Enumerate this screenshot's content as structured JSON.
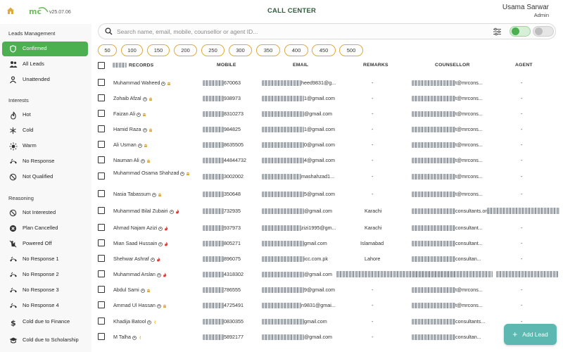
{
  "header": {
    "version": "v25.07.06",
    "title": "CALL CENTER",
    "user_name": "Usama Sarwar",
    "user_role": "Admin"
  },
  "sidebar": {
    "sections": [
      {
        "title": "Leads Management",
        "items": [
          {
            "label": "Confirmed",
            "icon": "shield-icon",
            "active": true
          },
          {
            "label": "All Leads",
            "icon": "users-icon"
          },
          {
            "label": "Unattended",
            "icon": "user-icon"
          }
        ]
      },
      {
        "title": "Interests",
        "items": [
          {
            "label": "Hot",
            "icon": "flame-icon"
          },
          {
            "label": "Cold",
            "icon": "snowflake-icon"
          },
          {
            "label": "Warm",
            "icon": "sun-icon"
          },
          {
            "label": "No Response",
            "icon": "phone-hangup-icon"
          },
          {
            "label": "Not Qualified",
            "icon": "ban-icon"
          }
        ]
      },
      {
        "title": "Reasoning",
        "items": [
          {
            "label": "Not Interested",
            "icon": "ban-icon"
          },
          {
            "label": "Plan Cancelled",
            "icon": "x-circle-icon"
          },
          {
            "label": "Powered Off",
            "icon": "power-off-icon"
          },
          {
            "label": "No Response 1",
            "icon": "phone-hangup-icon"
          },
          {
            "label": "No Response 2",
            "icon": "phone-hangup-icon"
          },
          {
            "label": "No Response 3",
            "icon": "phone-hangup-icon"
          },
          {
            "label": "No Response 4",
            "icon": "phone-hangup-icon"
          },
          {
            "label": "Cold due to Finance",
            "icon": "dollar-icon"
          },
          {
            "label": "Cold due to Scholarship",
            "icon": "graduation-cap-icon"
          }
        ]
      }
    ]
  },
  "search": {
    "placeholder": "Search name, email, mobile, counsellor or agent ID..."
  },
  "page_sizes": [
    "50",
    "100",
    "150",
    "200",
    "250",
    "300",
    "350",
    "400",
    "450",
    "500"
  ],
  "table": {
    "headers": {
      "records": "RECORDS",
      "mobile": "MOBILE",
      "email": "EMAIL",
      "remarks": "REMARKS",
      "counsellor": "COUNSELLOR",
      "agent": "AGENT"
    },
    "rows": [
      {
        "name": "Muhammad Waheed",
        "name2": "",
        "tag": "bank",
        "mobile": "670063",
        "email": "heed9831@g...",
        "remarks": "-",
        "counsellor": "t@mrcons...",
        "agent": "-"
      },
      {
        "name": "Zohaib Afzal",
        "name2": "",
        "tag": "bank",
        "mobile": "938973",
        "email": "1@gmail.com",
        "remarks": "-",
        "counsellor": "t@mrcons...",
        "agent": "-"
      },
      {
        "name": "Faizan Ali",
        "name2": "",
        "tag": "bank",
        "mobile": "8310273",
        "email": "@gmail.com",
        "remarks": "-",
        "counsellor": "t@mrcons...",
        "agent": "-"
      },
      {
        "name": "Hamid Raza",
        "name2": "",
        "tag": "bank",
        "mobile": "984825",
        "email": "1@gmail.com",
        "remarks": "-",
        "counsellor": "t@mrcons...",
        "agent": "-"
      },
      {
        "name": "Ali Usman",
        "name2": "",
        "tag": "bank",
        "mobile": "8635505",
        "email": "0@gmail.com",
        "remarks": "-",
        "counsellor": "t@mrcons...",
        "agent": "-"
      },
      {
        "name": "Nauman Ali",
        "name2": "",
        "tag": "bank",
        "mobile": "44844732",
        "email": "4@gmail.com",
        "remarks": "-",
        "counsellor": "t@mrcons...",
        "agent": "-"
      },
      {
        "name": "Muhammad Osama Shahzad",
        "name2": "",
        "tag": "bank",
        "mobile": "3002002",
        "email": "mashahzad1...",
        "remarks": "-",
        "counsellor": "t@mrcons...",
        "agent": "-"
      },
      {
        "name": "Nasia Tabassum",
        "name2": "",
        "tag": "bank",
        "mobile": "350648",
        "email": "5@gmail.com",
        "remarks": "-",
        "counsellor": "t@mrcons...",
        "agent": "-"
      },
      {
        "name": "Muhammad Bilal Zubairi",
        "name2": "",
        "tag": "flame",
        "mobile": "732935",
        "email": "@gmail.com",
        "remarks": "Karachi",
        "counsellor": "consultants.org",
        "agent": ""
      },
      {
        "name": "Ahmad Najam Azizi",
        "name2": "",
        "tag": "flame",
        "mobile": "937973",
        "email": "zizi1995@gm...",
        "remarks": "Karachi",
        "counsellor": "consultant...",
        "agent": "-"
      },
      {
        "name": "Mian Saad Hussain",
        "name2": "",
        "tag": "flame",
        "mobile": "805271",
        "email": "gmail.com",
        "remarks": "Islamabad",
        "counsellor": "consultant...",
        "agent": "-"
      },
      {
        "name": "Shehwar Ashraf",
        "name2": "",
        "tag": "flame",
        "mobile": "896075",
        "email": "icc.com.pk",
        "remarks": "Lahore",
        "counsellor": "consultan...",
        "agent": "-"
      },
      {
        "name": "Muhammad Arslan",
        "name2": "",
        "tag": "flame",
        "mobile": "4318302",
        "email": "@gmail.com",
        "remarks": "",
        "counsellor": "",
        "agent": ""
      },
      {
        "name": "Abdul Sami",
        "name2": "",
        "tag": "bank",
        "mobile": "786555",
        "email": "9@gmail.com",
        "remarks": "-",
        "counsellor": "t@mrcons...",
        "agent": "-"
      },
      {
        "name": "Ammad Ul Hassan",
        "name2": "",
        "tag": "bank",
        "mobile": "4725491",
        "email": "n9831@gmai...",
        "remarks": "-",
        "counsellor": "t@mrcons...",
        "agent": "-"
      },
      {
        "name": "Khadija Batool",
        "name2": "",
        "tag": "sun",
        "mobile": "0830355",
        "email": "gmail.com",
        "remarks": "-",
        "counsellor": "consultants...",
        "agent": "-"
      },
      {
        "name": "M Talha",
        "name2": "",
        "tag": "sun",
        "mobile": "5892177",
        "email": "@gmail.com",
        "remarks": "-",
        "counsellor": "consultan...",
        "agent": ""
      }
    ]
  },
  "add_lead": {
    "label": "Add Lead"
  },
  "colors": {
    "accent": "#4caf50",
    "title": "#2e5d3a",
    "pill_border": "#e0a93c",
    "fab": "#5cb8b0"
  }
}
